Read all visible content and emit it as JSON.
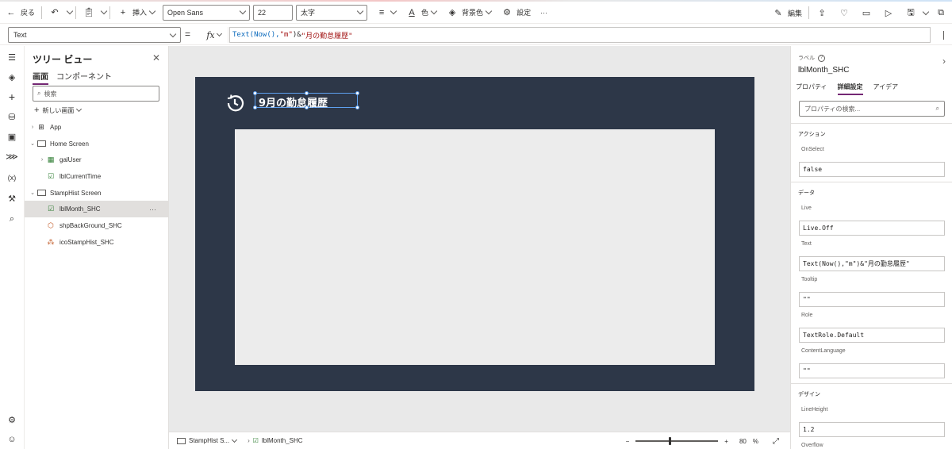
{
  "toolbar": {
    "back_label": "戻る",
    "insert_label": "挿入",
    "font_name": "Open Sans",
    "font_size": "22",
    "font_weight": "太字",
    "color_label": "色",
    "background_label": "背景色",
    "settings_label": "設定",
    "more_label": "···",
    "edit_label": "編集"
  },
  "formula_bar": {
    "property": "Text",
    "equals": "=",
    "fx": "fx",
    "formula_fn": "Text(Now(),",
    "formula_fmt": "\"m\"",
    "formula_amp": ")&",
    "formula_str": "\"月の勤怠履歴\""
  },
  "tree": {
    "title": "ツリー ビュー",
    "tabs": [
      {
        "label": "画面",
        "active": true
      },
      {
        "label": "コンポーネント",
        "active": false
      }
    ],
    "search_placeholder": "検索",
    "new_screen_label": "新しい画面",
    "items": [
      {
        "label": "App",
        "level": 0,
        "caret": "right",
        "icon": "app-icon"
      },
      {
        "label": "Home Screen",
        "level": 0,
        "caret": "down",
        "icon": "screen-icon"
      },
      {
        "label": "galUser",
        "level": 1,
        "caret": "right",
        "icon": "gallery-icon"
      },
      {
        "label": "lblCurrentTime",
        "level": 1,
        "caret": "none",
        "icon": "label-icon"
      },
      {
        "label": "StampHist Screen",
        "level": 0,
        "caret": "down",
        "icon": "screen-icon"
      },
      {
        "label": "lblMonth_SHC",
        "level": 1,
        "caret": "none",
        "icon": "label-icon",
        "selected": true
      },
      {
        "label": "shpBackGround_SHC",
        "level": 1,
        "caret": "none",
        "icon": "shape-icon"
      },
      {
        "label": "icoStampHist_SHC",
        "level": 1,
        "caret": "none",
        "icon": "icon-control-icon"
      }
    ],
    "more_label": "···"
  },
  "canvas": {
    "label_text": "9月の勤怠履歴",
    "screen_color": "#2d3748",
    "inner_color": "#ececec"
  },
  "status": {
    "screen_crumb": "StampHist S...",
    "control_crumb": "lblMonth_SHC",
    "zoom_minus": "−",
    "zoom_plus": "+",
    "zoom_value": "80",
    "zoom_unit": "%",
    "zoom_fraction": 0.4
  },
  "panel": {
    "type_label": "ラベル",
    "control_name": "lblMonth_SHC",
    "tabs": [
      {
        "label": "プロパティ",
        "active": false
      },
      {
        "label": "詳細設定",
        "active": true
      },
      {
        "label": "アイデア",
        "active": false
      }
    ],
    "search_placeholder": "プロパティの検索...",
    "sections": [
      {
        "title": "アクション",
        "props": [
          {
            "label": "OnSelect",
            "value": "false"
          }
        ]
      },
      {
        "title": "データ",
        "props": [
          {
            "label": "Live",
            "value": "Live.Off"
          },
          {
            "label": "Text",
            "value": "Text(Now(),\"m\")&\"月の勤怠履歴\""
          },
          {
            "label": "Tooltip",
            "value": "\"\""
          },
          {
            "label": "Role",
            "value": "TextRole.Default"
          },
          {
            "label": "ContentLanguage",
            "value": "\"\""
          }
        ]
      },
      {
        "title": "デザイン",
        "props": [
          {
            "label": "LineHeight",
            "value": "1.2"
          },
          {
            "label": "Overflow",
            "value": ""
          }
        ]
      }
    ]
  },
  "colors": {
    "accent": "#742774",
    "selection": "#5ea0ef"
  }
}
